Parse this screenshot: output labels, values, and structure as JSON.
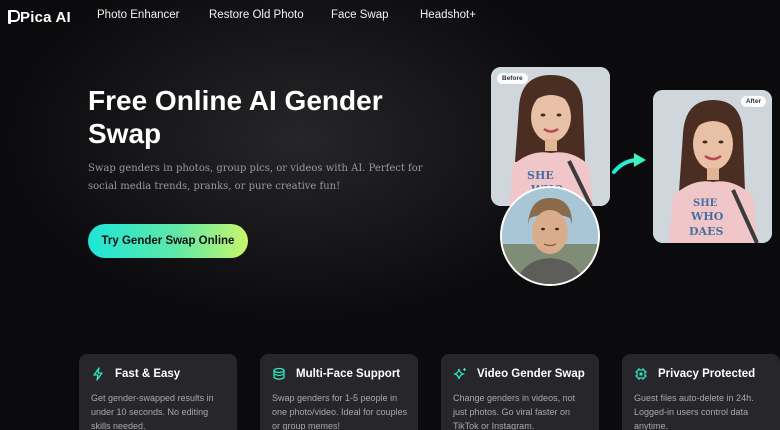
{
  "nav": {
    "logo": "Pica AI",
    "links": [
      "Photo Enhancer",
      "Restore Old Photo",
      "Face Swap",
      "Headshot+"
    ]
  },
  "hero": {
    "title": "Free Online AI Gender Swap",
    "subtitle": "Swap genders in photos, group pics, or videos with AI. Perfect for social media trends, pranks, or pure creative fun!",
    "cta": "Try Gender Swap Online"
  },
  "images": {
    "before_label": "Before",
    "after_label": "After"
  },
  "features": [
    {
      "title": "Fast & Easy",
      "icon": "lightning-icon",
      "desc": "Get gender-swapped results in under 10 seconds. No editing skills needed."
    },
    {
      "title": "Multi-Face Support",
      "icon": "layers-icon",
      "desc": "Swap genders for 1-5 people in one photo/video. Ideal for couples or group memes!"
    },
    {
      "title": "Video Gender Swap",
      "icon": "sparkle-icon",
      "desc": "Change genders in videos, not just photos. Go viral faster on TikTok or Instagram."
    },
    {
      "title": "Privacy Protected",
      "icon": "chip-icon",
      "desc": "Guest files auto-delete in 24h. Logged-in users control data anytime."
    }
  ],
  "colors": {
    "background": "#0b0b0d",
    "card": "#26262b",
    "accent_start": "#1ee5d8",
    "accent_end": "#c9f56a",
    "icon": "#2ee6c4"
  }
}
